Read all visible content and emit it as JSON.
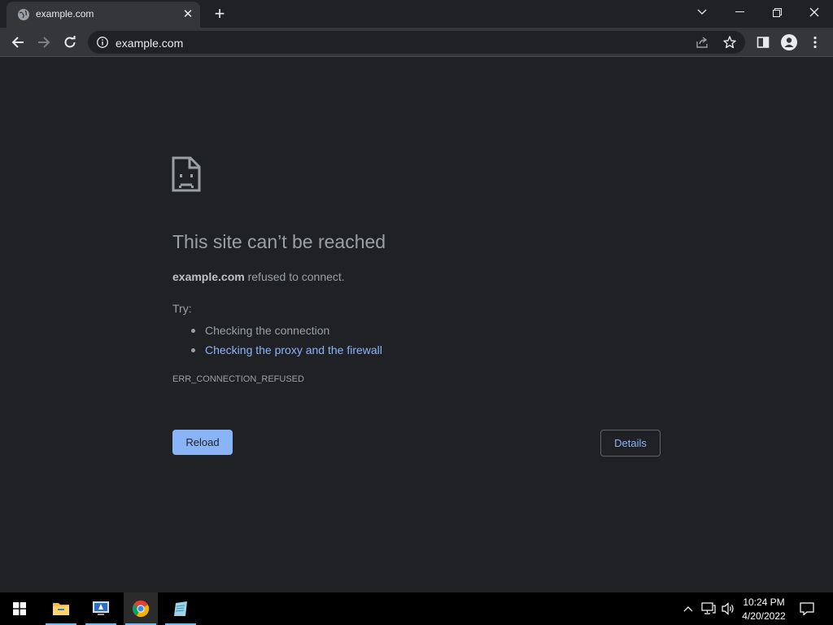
{
  "browser": {
    "tab": {
      "title": "example.com",
      "close_glyph": "✕"
    },
    "new_tab_glyph": "+",
    "omnibox": {
      "url": "example.com"
    },
    "icons": [
      "globe-icon",
      "close-icon",
      "plus-icon",
      "chevron-down-icon",
      "minimize-icon",
      "restore-icon",
      "window-close-icon",
      "back-arrow-icon",
      "forward-arrow-icon",
      "reload-icon",
      "info-icon",
      "share-icon",
      "star-icon",
      "side-panel-icon",
      "profile-icon",
      "more-menu-icon"
    ]
  },
  "error_page": {
    "title": "This site can’t be reached",
    "host": "example.com",
    "description_rest": " refused to connect.",
    "try_label": "Try:",
    "suggestions": [
      "Checking the connection",
      "Checking the proxy and the firewall"
    ],
    "error_code": "ERR_CONNECTION_REFUSED",
    "reload_label": "Reload",
    "details_label": "Details"
  },
  "taskbar": {
    "items": [
      "start-icon",
      "file-explorer-icon",
      "remote-desktop-icon",
      "chrome-icon",
      "notepad-icon"
    ],
    "tray_icons": [
      "chevron-up-icon",
      "network-icon",
      "volume-icon",
      "notification-icon"
    ],
    "time": "10:24 PM",
    "date": "4/20/2022"
  },
  "colors": {
    "page_bg": "#202124",
    "toolbar_bg": "#35363a",
    "link": "#8ab4f8",
    "text_muted": "#9aa0a6"
  }
}
